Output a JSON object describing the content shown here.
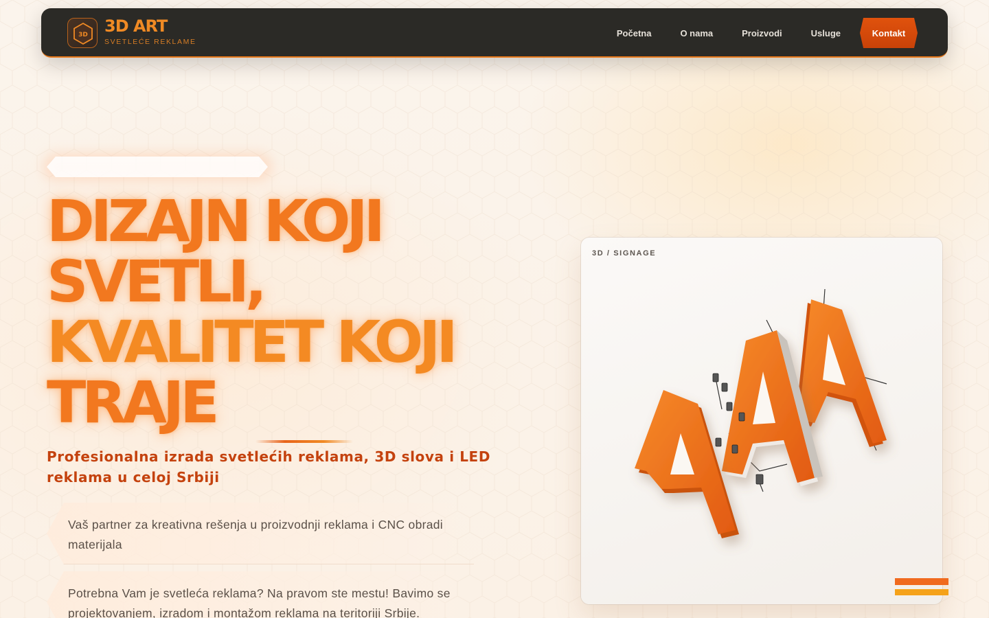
{
  "brand": {
    "badge_text": "3D",
    "title": "3D ART",
    "subtitle": "SVETLEĆE REKLAME"
  },
  "nav": {
    "items": [
      {
        "label": "Početna"
      },
      {
        "label": "O nama"
      },
      {
        "label": "Proizvodi"
      },
      {
        "label": "Usluge"
      }
    ],
    "cta": "Kontakt"
  },
  "hero": {
    "headline_lines": [
      "DIZAJN KOJI",
      "SVETLI,",
      "KVALITET KOJI",
      "TRAJE"
    ],
    "subheading": "Profesionalna izrada svetlećih reklama, 3D slova i LED reklama u celoj Srbiji",
    "cards": [
      {
        "text": "Vaš partner za kreativna rešenja u proizvodnji reklama i CNC obradi materijala"
      },
      {
        "text": "Potrebna Vam je svetleća reklama? Na pravom ste mestu! Bavimo se projektovanjem, izradom i montažom reklama na teritoriji Srbije."
      }
    ]
  },
  "showcase": {
    "label": "3D / SIGNAGE",
    "image_subject": "3d-letter-a-signs"
  },
  "colors": {
    "accent": "#f2781f",
    "accent_dark": "#c4420e",
    "nav_bg": "#2b2a26",
    "cta_bg": "#d84a0b",
    "page_bg": "#fbf3ea"
  }
}
